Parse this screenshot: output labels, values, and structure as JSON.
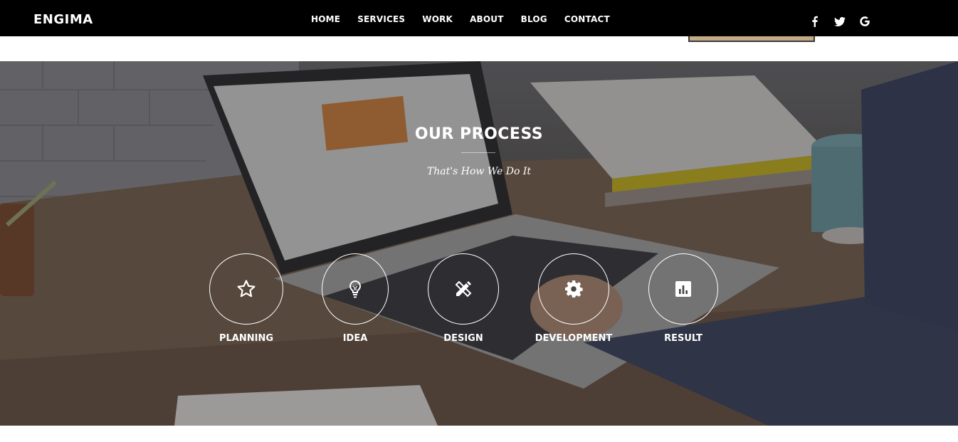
{
  "brand": "ENGIMA",
  "nav": {
    "items": [
      "HOME",
      "SERVICES",
      "WORK",
      "ABOUT",
      "BLOG",
      "CONTACT"
    ]
  },
  "socials": [
    "facebook-icon",
    "twitter-icon",
    "google-icon"
  ],
  "process": {
    "title": "OUR PROCESS",
    "subtitle": "That's How We Do It",
    "steps": [
      {
        "label": "PLANNING",
        "icon": "star-icon"
      },
      {
        "label": "IDEA",
        "icon": "lightbulb-icon"
      },
      {
        "label": "DESIGN",
        "icon": "pencil-ruler-icon"
      },
      {
        "label": "DEVELOPMENT",
        "icon": "gear-icon"
      },
      {
        "label": "RESULT",
        "icon": "bar-chart-icon"
      }
    ]
  },
  "colors": {
    "navbar": "#000000",
    "text": "#ffffff",
    "accent": "#c5ab85"
  }
}
